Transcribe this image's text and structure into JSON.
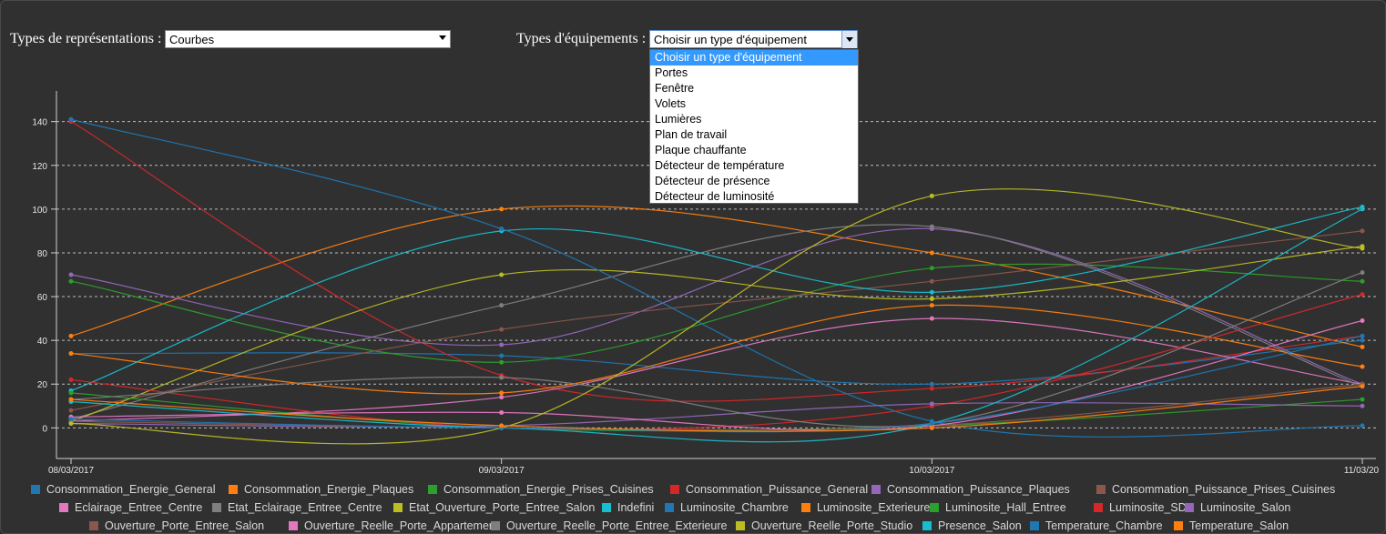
{
  "controls": {
    "representation_label": "Types de représentations :",
    "representation_value": "Courbes",
    "equipment_label": "Types d'équipements :",
    "equipment_value": "Choisir un type d'équipement",
    "equipment_options": [
      "Choisir un type d'équipement",
      "Portes",
      "Fenêtre",
      "Volets",
      "Lumières",
      "Plan de travail",
      "Plaque chauffante",
      "Détecteur de température",
      "Détecteur de présence",
      "Détecteur de luminosité"
    ],
    "equipment_selected_index": 0
  },
  "chart_data": {
    "type": "line",
    "categories": [
      "08/03/2017",
      "09/03/2017",
      "10/03/2017",
      "11/03/20"
    ],
    "ylim": [
      -14,
      154
    ],
    "yticks": [
      0,
      20,
      40,
      60,
      80,
      100,
      120,
      140
    ],
    "grid": true,
    "legend_position": "bottom",
    "series": [
      {
        "name": "Consommation_Energie_General",
        "color": "#1f77b4",
        "values": [
          34,
          33,
          20,
          40
        ]
      },
      {
        "name": "Consommation_Energie_Plaques",
        "color": "#ff7f0e",
        "values": [
          42,
          100,
          80,
          37
        ]
      },
      {
        "name": "Consommation_Energie_Prises_Cuisines",
        "color": "#2ca02c",
        "values": [
          67,
          30,
          73,
          67
        ]
      },
      {
        "name": "Consommation_Puissance_General",
        "color": "#d62728",
        "values": [
          140,
          24,
          18,
          42
        ]
      },
      {
        "name": "Consommation_Puissance_Plaques",
        "color": "#9467bd",
        "values": [
          70,
          38,
          91,
          20
        ]
      },
      {
        "name": "Consommation_Puissance_Prises_Cuisines",
        "color": "#8c564b",
        "values": [
          8,
          45,
          67,
          90
        ]
      },
      {
        "name": "Eclairage_Entree_Centre",
        "color": "#e377c2",
        "values": [
          3,
          14,
          50,
          20
        ]
      },
      {
        "name": "Etat_Eclairage_Entree_Centre",
        "color": "#7f7f7f",
        "values": [
          4,
          56,
          92,
          19
        ]
      },
      {
        "name": "Etat_Ouverture_Porte_Entree_Salon",
        "color": "#bcbd22",
        "values": [
          3,
          70,
          59,
          83
        ]
      },
      {
        "name": "Indefini",
        "color": "#17becf",
        "values": [
          17,
          90,
          62,
          101
        ]
      },
      {
        "name": "Luminosite_Chambre",
        "color": "#1f77b4",
        "values": [
          141,
          91,
          3,
          1
        ]
      },
      {
        "name": "Luminosite_Exterieure",
        "color": "#ff7f0e",
        "values": [
          34,
          16,
          56,
          28
        ]
      },
      {
        "name": "Luminosite_Hall_Entree",
        "color": "#2ca02c",
        "values": [
          16,
          0,
          1,
          13
        ]
      },
      {
        "name": "Luminosite_SDB",
        "color": "#d62728",
        "values": [
          22,
          0,
          10,
          61
        ]
      },
      {
        "name": "Luminosite_Salon",
        "color": "#9467bd",
        "values": [
          2,
          1,
          11,
          10
        ]
      },
      {
        "name": "Ouverture_Porte_Entree_Salon",
        "color": "#8c564b",
        "values": [
          3,
          0,
          1,
          20
        ]
      },
      {
        "name": "Ouverture_Reelle_Porte_Appartement",
        "color": "#e377c2",
        "values": [
          5,
          7,
          1,
          49
        ]
      },
      {
        "name": "Ouverture_Reelle_Porte_Entree_Exterieure",
        "color": "#7f7f7f",
        "values": [
          13,
          23,
          2,
          71
        ]
      },
      {
        "name": "Ouverture_Reelle_Porte_Studio",
        "color": "#bcbd22",
        "values": [
          2,
          0,
          106,
          82
        ]
      },
      {
        "name": "Presence_Salon",
        "color": "#17becf",
        "values": [
          12,
          0,
          2,
          100
        ]
      },
      {
        "name": "Temperature_Chambre",
        "color": "#1f77b4",
        "values": [
          4,
          0,
          2,
          42
        ]
      },
      {
        "name": "Temperature_Salon",
        "color": "#ff7f0e",
        "values": [
          13,
          1,
          0,
          19
        ]
      }
    ]
  }
}
